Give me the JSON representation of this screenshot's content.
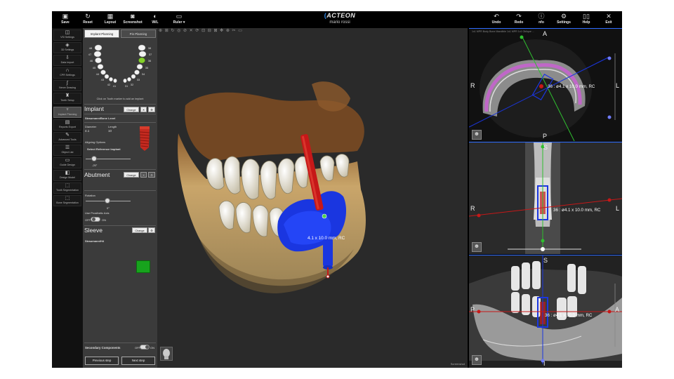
{
  "toolbar": {
    "save": "Save",
    "reset": "Reset",
    "layout": "Layout",
    "screenshot": "Screenshot",
    "wl": "W/L",
    "ruler": "Ruler",
    "undo": "Undo",
    "redo": "Redo",
    "info": "nfo",
    "settings": "Settings",
    "help": "Help",
    "exit": "Exit"
  },
  "brand": {
    "logo": "ACTEON",
    "user": "mario rossi"
  },
  "nav": [
    {
      "label": "VSI Settings",
      "icon": "◫"
    },
    {
      "label": "3D Settings",
      "icon": "◈"
    },
    {
      "label": "Data Import",
      "icon": "⇩"
    },
    {
      "label": "CPR Settings",
      "icon": "∩"
    },
    {
      "label": "Nerve Drawing",
      "icon": "∫"
    },
    {
      "label": "Teeth Setup",
      "icon": "♜"
    },
    {
      "label": "Implant Planning",
      "icon": "♆"
    },
    {
      "label": "Reports Export",
      "icon": "▤"
    },
    {
      "label": "Advanced Tools",
      "icon": "✎"
    },
    {
      "label": "Object List",
      "icon": "☰"
    },
    {
      "label": "Guide Design",
      "icon": "▭"
    },
    {
      "label": "Design Model",
      "icon": "◧"
    },
    {
      "label": "Tooth Segmentation",
      "icon": "⬚"
    },
    {
      "label": "Bone Segmentation",
      "icon": "⬚"
    }
  ],
  "panel": {
    "tab_implant": "Implant Planning",
    "tab_pin": "Pin Planning",
    "tooth_hint": "Click on Tooth marker to add an implant",
    "implant_title": "Implant",
    "change": "Change",
    "implant_model": "Straumann/Bone Level",
    "diameter_label": "Diameter",
    "diameter_value": "4.1",
    "length_label": "Length",
    "length_value": "10",
    "aligning_label": "Aligning Options",
    "select_ref": "Select Reference Implant",
    "angle_value": "-25°",
    "abutment_title": "Abutment",
    "rotation_label": "Rotation",
    "rotation_value": "0°",
    "prosthetic_label": "Use Prosthetic Axis",
    "off": "OFF",
    "on": "ON",
    "sleeve_title": "Sleeve",
    "sleeve_model": "Straumann/H4",
    "secondary_label": "Secondary Components",
    "prev": "Previous step",
    "next": "Next step"
  },
  "teeth": {
    "upper_left": [
      "48",
      "47",
      "46",
      "45",
      "44",
      "43",
      "42",
      "41"
    ],
    "upper_right": [
      "38",
      "37",
      "36",
      "35",
      "34",
      "33",
      "32",
      "31"
    ],
    "selected": "36"
  },
  "view3d": {
    "tools": "⊕ ⊞ ↻ ◎ ⊘ ✕ ⟳ ⊡ ⊟ ⊠ ✥ ⊕ ✂ ▭",
    "implant_label": "4.1 x 10.0 mm, RC",
    "screenshot_label": "Screenshot"
  },
  "ct": {
    "axial": {
      "top": "A",
      "bottom": "P",
      "left": "R",
      "right": "L",
      "measurement": "36 : ø4.1 x 10.0 mm, RC"
    },
    "sag1": {
      "top": "S",
      "left": "R",
      "right": "L",
      "measurement": "36 : ø4.1 x 10.0 mm, RC"
    },
    "sag2": {
      "top": "S",
      "bottom": "I",
      "left": "P",
      "right": "A",
      "measurement": "36 : ø4.1 x 10.0 mm, RC"
    },
    "toolbar": "1x1  MPR  Body  Bone  Mandible 1x1  MPR 1x1  Oblique  ..."
  },
  "colors": {
    "implant": "#c61818",
    "guide": "#1a36e0",
    "bone": "#c9b27a",
    "accent": "#2d8cf0"
  }
}
